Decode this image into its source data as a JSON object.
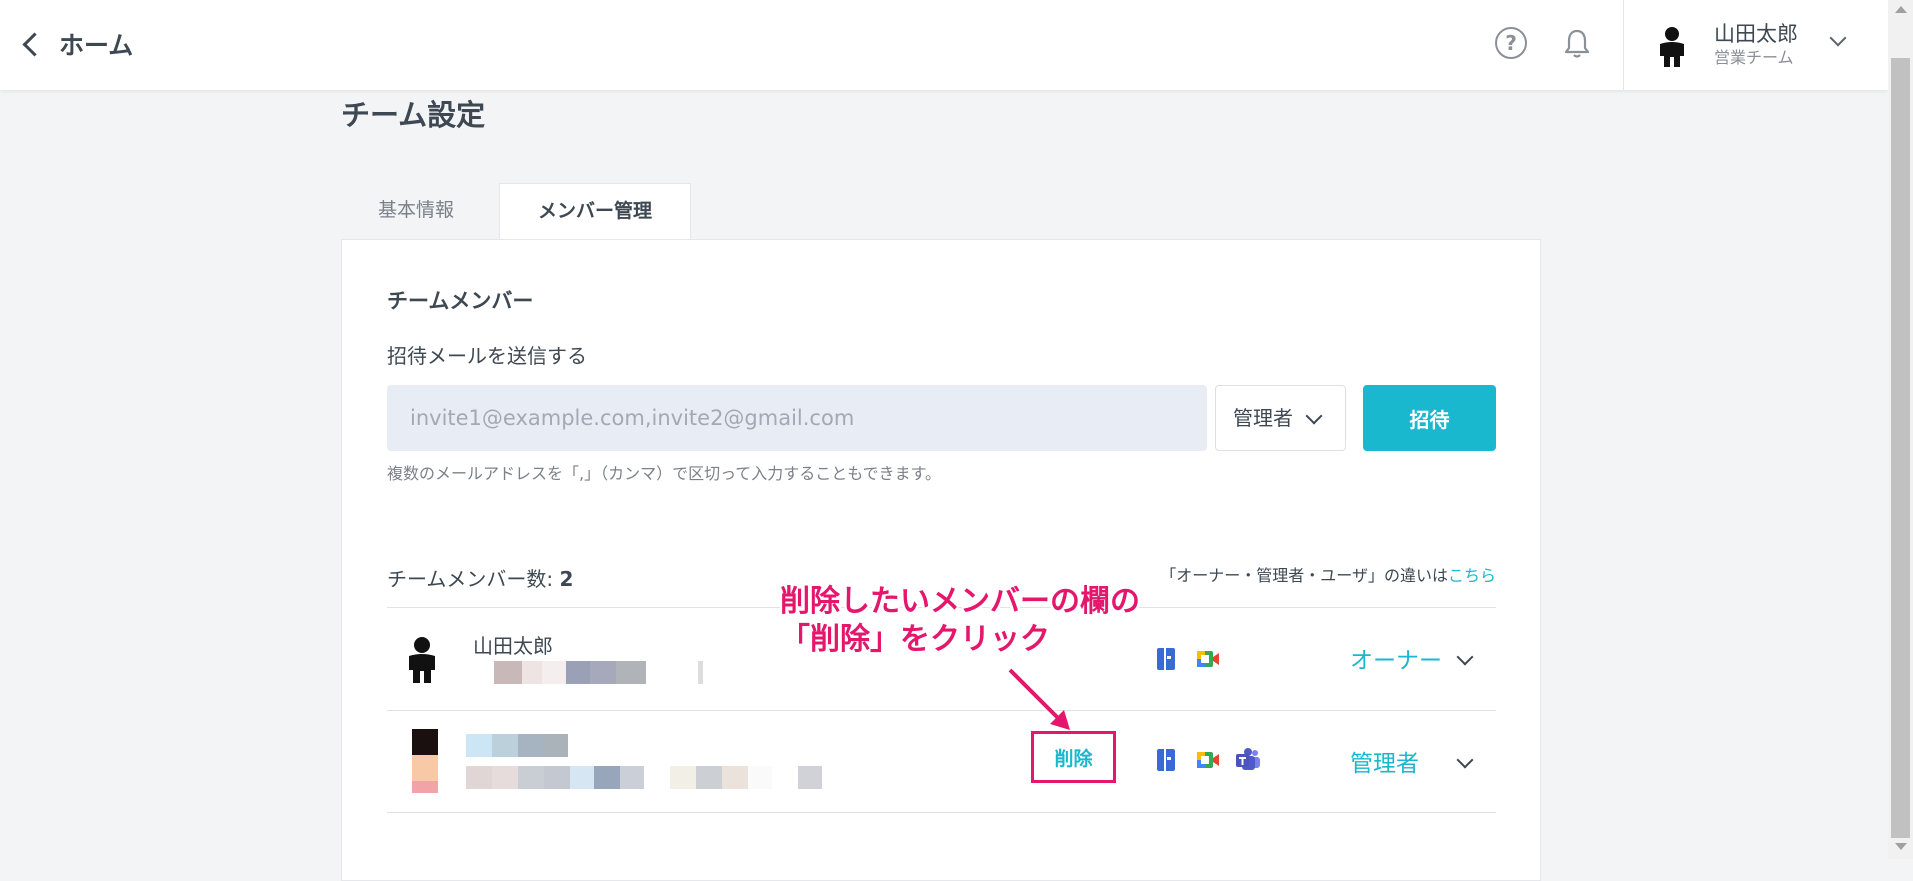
{
  "header": {
    "back_label": "ホーム",
    "user_name": "山田太郎",
    "user_team": "営業チーム"
  },
  "page": {
    "title": "チーム設定",
    "tabs": [
      {
        "label": "基本情報",
        "active": false
      },
      {
        "label": "メンバー管理",
        "active": true
      }
    ]
  },
  "members_section": {
    "title": "チームメンバー",
    "invite_label": "招待メールを送信する",
    "invite_placeholder": "invite1@example.com,invite2@gmail.com",
    "invite_value": "",
    "role_selected": "管理者",
    "invite_button": "招待",
    "hint": "複数のメールアドレスを「,」（カンマ）で区切って入力することもできます。",
    "count_label": "チームメンバー数:",
    "count": "2",
    "role_diff_text": "「オーナー・管理者・ユーザ」の違いは",
    "role_diff_link": "こちら"
  },
  "members": [
    {
      "name": "山田太郎",
      "role": "オーナー",
      "services": [
        "book-icon",
        "meet-icon"
      ]
    },
    {
      "name": "",
      "role": "管理者",
      "delete_label": "削除",
      "services": [
        "book-icon",
        "meet-icon",
        "teams-icon"
      ]
    }
  ],
  "annotation": {
    "line1": "削除したいメンバーの欄の",
    "line2": "「削除」をクリック"
  },
  "colors": {
    "accent": "#1ab8cf",
    "annotation": "#e5176d",
    "text": "#3d4852",
    "background": "#f3f4f6"
  }
}
